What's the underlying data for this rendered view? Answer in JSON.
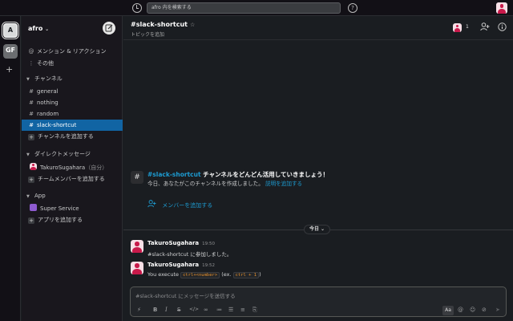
{
  "topbar": {
    "search_placeholder": "afro 内を検索する",
    "help_icon": "?"
  },
  "rail": {
    "workspaces": [
      "A",
      "GF"
    ],
    "add": "+"
  },
  "sidebar": {
    "workspace_name": "afro",
    "workspace_chevron": "⌄",
    "mentions": "メンション & リアクション",
    "other": "その他",
    "channels_header": "チャンネル",
    "channels": [
      {
        "name": "general"
      },
      {
        "name": "nothing"
      },
      {
        "name": "random"
      },
      {
        "name": "slack-shortcut",
        "active": true
      }
    ],
    "add_channel": "チャンネルを追加する",
    "dm_header": "ダイレクトメッセージ",
    "dm_user": "TakuroSugahara",
    "dm_self": "（自分）",
    "add_team": "チームメンバーを追加する",
    "app_header": "App",
    "app_name": "Super Service",
    "add_app": "アプリを追加する"
  },
  "header": {
    "channel": "#slack-shortcut",
    "star": "☆",
    "topic": "トピックを追加",
    "member_count": "1"
  },
  "intro": {
    "hash": "#",
    "channel_link": "#slack-shortcut",
    "title_rest": " チャンネルをどんどん活用していきましょう！",
    "desc": "今日、あなたがこのチャンネルを作成しました。",
    "desc_link": "説明を追加する",
    "add_members": "メンバーを追加する"
  },
  "divider": {
    "label": "今日 ⌄"
  },
  "messages": [
    {
      "user": "TakuroSugahara",
      "time": "19:50",
      "text": "#slack-shortcut に参加しました。"
    },
    {
      "user": "TakuroSugahara",
      "time": "19:52",
      "text_prefix": "You execute ",
      "code1": "ctrl+<number>",
      "text_mid": " (ex. ",
      "code2": "ctrl + 1",
      "text_suffix": ")"
    }
  ],
  "composer": {
    "placeholder": "#slack-shortcut にメッセージを送信する",
    "format_button": "Aa"
  },
  "colors": {
    "accent": "#1164a3",
    "link": "#1d9bd1",
    "code": "#e8912d"
  }
}
